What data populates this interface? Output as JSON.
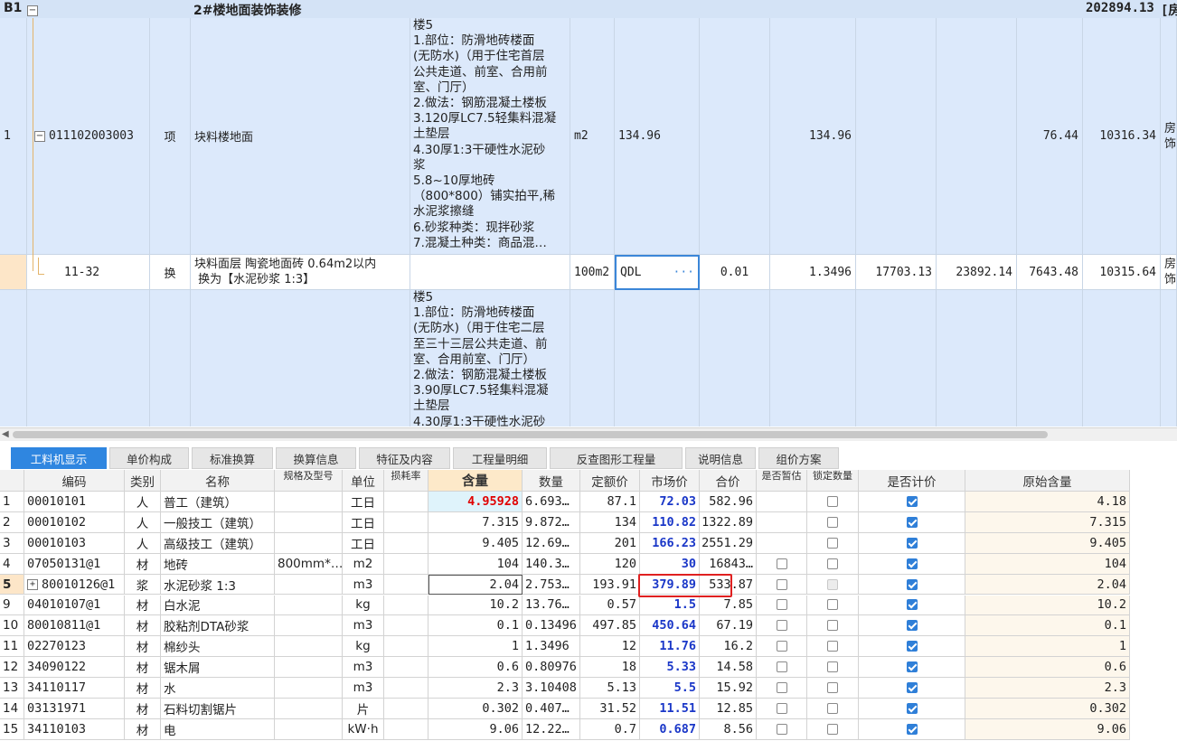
{
  "upper": {
    "header": {
      "id": "B1",
      "title": "2#楼地面装饰装修",
      "total": "202894.13",
      "extra": "[房"
    },
    "row1": {
      "num": "1",
      "code": "011102003003",
      "type": "项",
      "name": "块料楼地面",
      "desc": "楼5\n1.部位：防滑地砖楼面\n(无防水)（用于住宅首层\n公共走道、前室、合用前\n室、门厅）\n2.做法：钢筋混凝土楼板\n3.120厚LC7.5轻集料混凝\n土垫层\n4.30厚1:3干硬性水泥砂\n浆\n5.8~10厚地砖\n（800*800）铺实拍平,稀\n水泥浆擦缝\n6.砂浆种类：现拌砂浆\n7.混凝土种类：商品混…",
      "unit": "m2",
      "qty_expr": "134.96",
      "qty": "134.96",
      "price": "76.44",
      "amount": "10316.34",
      "extra": "房\n饰"
    },
    "row2": {
      "code": "11-32",
      "type": "换",
      "name": "块料面层 陶瓷地面砖 0.64m2以内\n 换为【水泥砂浆 1:3】",
      "unit": "100m2",
      "qty_expr": "QDL",
      "ellipsis": "···",
      "content": "0.01",
      "qty": "1.3496",
      "c1": "17703.13",
      "c2": "23892.14",
      "price": "7643.48",
      "amount": "10315.64",
      "extra": "房\n饰"
    },
    "row3": {
      "desc": "楼5\n1.部位：防滑地砖楼面\n(无防水)（用于住宅二层\n至三十三层公共走道、前\n室、合用前室、门厅）\n2.做法：钢筋混凝土楼板\n3.90厚LC7.5轻集料混凝\n土垫层\n4.30厚1:3干硬性水泥砂"
    }
  },
  "tabs": [
    "工料机显示",
    "单价构成",
    "标准换算",
    "换算信息",
    "特征及内容",
    "工程量明细",
    "反查图形工程量",
    "说明信息",
    "组价方案"
  ],
  "lower": {
    "headers": {
      "code": "编码",
      "cat": "类别",
      "name": "名称",
      "spec": "规格及型号",
      "unit": "单位",
      "loss": "损耗率",
      "content": "含量",
      "qty": "数量",
      "quota": "定额价",
      "market": "市场价",
      "total": "合价",
      "temp": "是否暂估",
      "lock": "锁定数量",
      "priced": "是否计价",
      "orig": "原始含量"
    },
    "rows": [
      {
        "n": "1",
        "code": "00010101",
        "cat": "人",
        "name": "普工（建筑）",
        "spec": "",
        "unit": "工日",
        "content": "4.95928",
        "qty": "6.693…",
        "quota": "87.1",
        "market": "72.03",
        "total": "582.96",
        "temp": null,
        "lock": false,
        "priced": true,
        "orig": "4.18"
      },
      {
        "n": "2",
        "code": "00010102",
        "cat": "人",
        "name": "一般技工（建筑）",
        "spec": "",
        "unit": "工日",
        "content": "7.315",
        "qty": "9.872…",
        "quota": "134",
        "market": "110.82",
        "total": "1322.89",
        "temp": null,
        "lock": false,
        "priced": true,
        "orig": "7.315"
      },
      {
        "n": "3",
        "code": "00010103",
        "cat": "人",
        "name": "高级技工（建筑）",
        "spec": "",
        "unit": "工日",
        "content": "9.405",
        "qty": "12.69…",
        "quota": "201",
        "market": "166.23",
        "total": "2551.29",
        "temp": null,
        "lock": false,
        "priced": true,
        "orig": "9.405"
      },
      {
        "n": "4",
        "code": "07050131@1",
        "cat": "材",
        "name": "地砖",
        "spec": "800mm*…",
        "unit": "m2",
        "content": "104",
        "qty": "140.3…",
        "quota": "120",
        "market": "30",
        "total": "16843…",
        "temp": false,
        "lock": false,
        "priced": true,
        "orig": "104"
      },
      {
        "n": "5",
        "code": "80010126@1",
        "cat": "浆",
        "name": "水泥砂浆 1:3",
        "spec": "",
        "unit": "m3",
        "content": "2.04",
        "qty": "2.753…",
        "quota": "193.91",
        "market": "379.89",
        "total": "533.87",
        "temp": false,
        "lock": "dis",
        "priced": true,
        "orig": "2.04",
        "tree": "+"
      },
      {
        "n": "9",
        "code": "04010107@1",
        "cat": "材",
        "name": "白水泥",
        "spec": "",
        "unit": "kg",
        "content": "10.2",
        "qty": "13.76…",
        "quota": "0.57",
        "market": "1.5",
        "total": "7.85",
        "temp": false,
        "lock": false,
        "priced": true,
        "orig": "10.2"
      },
      {
        "n": "10",
        "code": "80010811@1",
        "cat": "材",
        "name": "胶粘剂DTA砂浆",
        "spec": "",
        "unit": "m3",
        "content": "0.1",
        "qty": "0.13496",
        "quota": "497.85",
        "market": "450.64",
        "total": "67.19",
        "temp": false,
        "lock": false,
        "priced": true,
        "orig": "0.1"
      },
      {
        "n": "11",
        "code": "02270123",
        "cat": "材",
        "name": "棉纱头",
        "spec": "",
        "unit": "kg",
        "content": "1",
        "qty": "1.3496",
        "quota": "12",
        "market": "11.76",
        "total": "16.2",
        "temp": false,
        "lock": false,
        "priced": true,
        "orig": "1"
      },
      {
        "n": "12",
        "code": "34090122",
        "cat": "材",
        "name": "锯木屑",
        "spec": "",
        "unit": "m3",
        "content": "0.6",
        "qty": "0.80976",
        "quota": "18",
        "market": "5.33",
        "total": "14.58",
        "temp": false,
        "lock": false,
        "priced": true,
        "orig": "0.6"
      },
      {
        "n": "13",
        "code": "34110117",
        "cat": "材",
        "name": "水",
        "spec": "",
        "unit": "m3",
        "content": "2.3",
        "qty": "3.10408",
        "quota": "5.13",
        "market": "5.5",
        "total": "15.92",
        "temp": false,
        "lock": false,
        "priced": true,
        "orig": "2.3"
      },
      {
        "n": "14",
        "code": "03131971",
        "cat": "材",
        "name": "石料切割锯片",
        "spec": "",
        "unit": "片",
        "content": "0.302",
        "qty": "0.407…",
        "quota": "31.52",
        "market": "11.51",
        "total": "12.85",
        "temp": false,
        "lock": false,
        "priced": true,
        "orig": "0.302"
      },
      {
        "n": "15",
        "code": "34110103",
        "cat": "材",
        "name": "电",
        "spec": "",
        "unit": "kW·h",
        "content": "9.06",
        "qty": "12.22…",
        "quota": "0.7",
        "market": "0.687",
        "total": "8.56",
        "temp": false,
        "lock": false,
        "priced": true,
        "orig": "9.06"
      }
    ]
  },
  "colors": {
    "selection_blue": "#dce9fb",
    "active_tab": "#2f86e0",
    "market_text": "#1a37c8",
    "highlight_red": "#e00000"
  }
}
